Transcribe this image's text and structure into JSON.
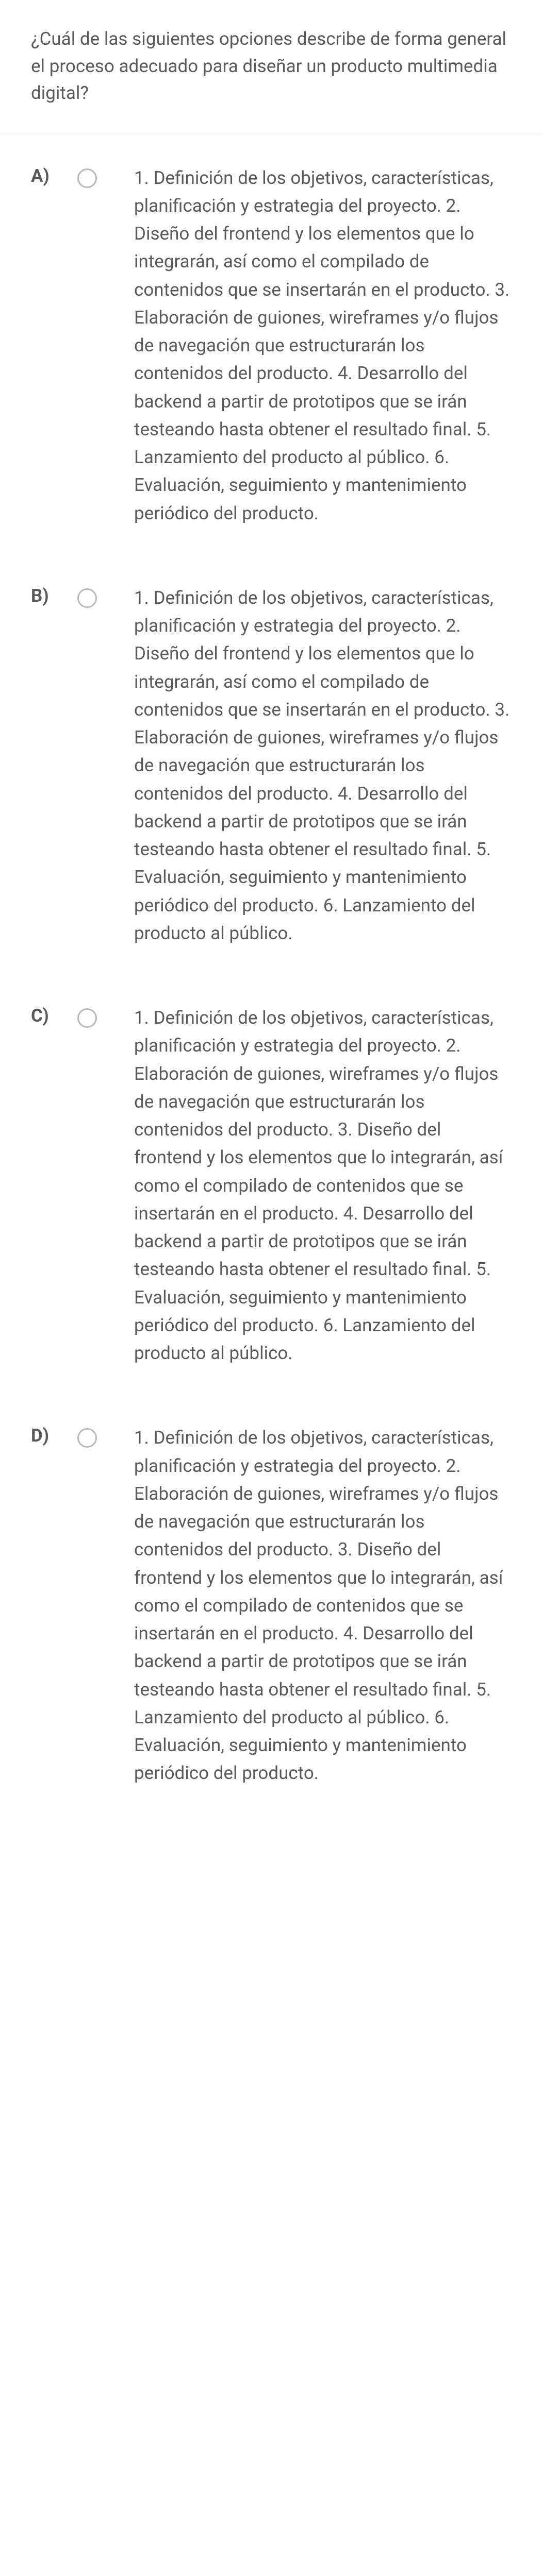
{
  "question": "¿Cuál de las siguientes opciones describe de forma general el proceso adecuado para diseñar un producto multimedia digital?",
  "options": [
    {
      "letter": "A)",
      "text": "1. Definición de los objetivos, características, planificación y estrategia del proyecto. 2. Diseño del frontend y los elementos que lo integrarán, así como el compilado de contenidos que se insertarán en el producto. 3. Elaboración de guiones, wireframes y/o flujos de navegación que estructurarán los contenidos del producto. 4. Desarrollo del backend a partir de prototipos que se irán testeando hasta obtener el resultado final. 5. Lanzamiento del producto al público. 6. Evaluación, seguimiento y mantenimiento periódico del producto."
    },
    {
      "letter": "B)",
      "text": "1. Definición de los objetivos, características, planificación y estrategia del proyecto. 2. Diseño del frontend y los elementos que lo integrarán, así como el compilado de contenidos que se insertarán en el producto. 3. Elaboración de guiones, wireframes y/o flujos de navegación que estructurarán los contenidos del producto. 4. Desarrollo del backend a partir de prototipos que se irán testeando hasta obtener el resultado final. 5. Evaluación, seguimiento y mantenimiento periódico del producto. 6. Lanzamiento del producto al público."
    },
    {
      "letter": "C)",
      "text": "1. Definición de los objetivos, características, planificación y estrategia del proyecto. 2. Elaboración de guiones, wireframes y/o flujos de navegación que estructurarán los contenidos del producto. 3. Diseño del frontend y los elementos que lo integrarán, así como el compilado de contenidos que se insertarán en el producto. 4. Desarrollo del backend a partir de prototipos que se irán testeando hasta obtener el resultado final. 5. Evaluación, seguimiento y mantenimiento periódico del producto. 6. Lanzamiento del producto al público."
    },
    {
      "letter": "D)",
      "text": "1. Definición de los objetivos, características, planificación y estrategia del proyecto. 2. Elaboración de guiones, wireframes y/o flujos de navegación que estructurarán los contenidos del producto. 3. Diseño del frontend y los elementos que lo integrarán, así como el compilado de contenidos que se insertarán en el producto. 4. Desarrollo del backend a partir de prototipos que se irán testeando hasta obtener el resultado final. 5. Lanzamiento del producto al público. 6. Evaluación, seguimiento y mantenimiento periódico del producto."
    }
  ]
}
